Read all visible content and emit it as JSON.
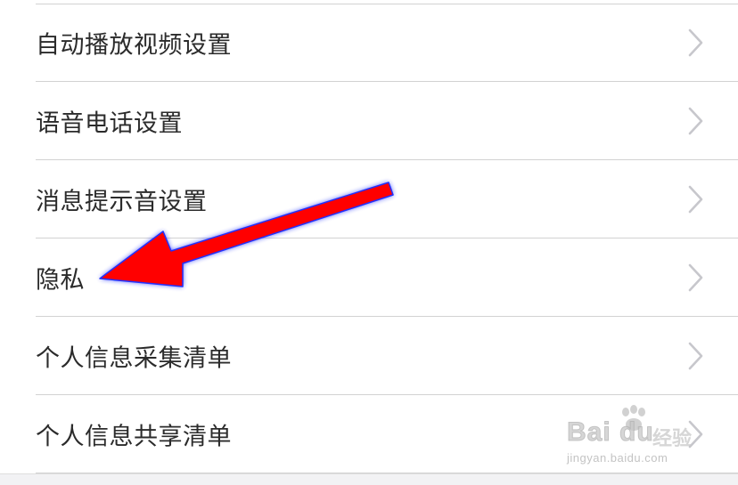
{
  "settings": {
    "items": [
      {
        "label": "自动播放视频设置"
      },
      {
        "label": "语音电话设置"
      },
      {
        "label": "消息提示音设置"
      },
      {
        "label": "隐私"
      },
      {
        "label": "个人信息采集清单"
      },
      {
        "label": "个人信息共享清单"
      }
    ],
    "chevron_icon": "chevron-right-icon"
  },
  "annotation": {
    "arrow_color": "#ff0000",
    "arrow_glow_color": "#1e2bff",
    "points_to": "隐私"
  },
  "watermark": {
    "brand": "Bai du",
    "jingyan": "经验",
    "url": "jingyan.baidu.com"
  },
  "colors": {
    "divider": "#d2d2d2",
    "text": "#2b2b2b",
    "chevron": "#c7c7cc",
    "background": "#ffffff"
  }
}
